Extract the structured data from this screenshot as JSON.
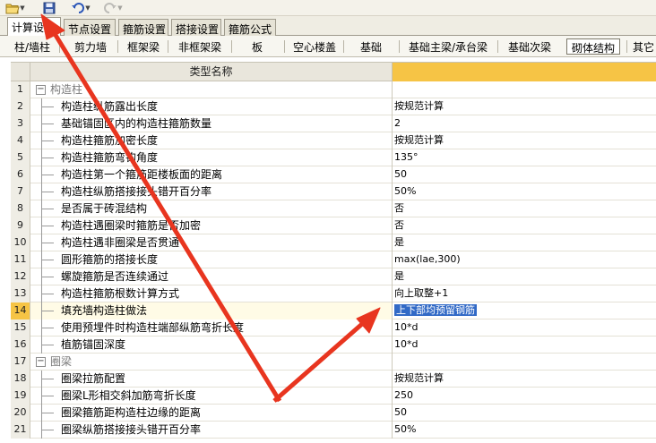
{
  "toolbar": {
    "icons": [
      "open-folder-icon",
      "save-icon",
      "undo-icon",
      "redo-icon"
    ]
  },
  "tabs_top": [
    {
      "label": "计算设置",
      "active": true
    },
    {
      "label": "节点设置",
      "active": false
    },
    {
      "label": "箍筋设置",
      "active": false
    },
    {
      "label": "搭接设置",
      "active": false
    },
    {
      "label": "箍筋公式",
      "active": false
    }
  ],
  "tabs_components": [
    {
      "label": "柱/墙柱",
      "active": false
    },
    {
      "label": "剪力墙",
      "active": false
    },
    {
      "label": "框架梁",
      "active": false
    },
    {
      "label": "非框架梁",
      "active": false
    },
    {
      "label": "板",
      "active": false
    },
    {
      "label": "空心楼盖",
      "active": false
    },
    {
      "label": "基础",
      "active": false
    },
    {
      "label": "基础主梁/承台梁",
      "active": false
    },
    {
      "label": "基础次梁",
      "active": false
    },
    {
      "label": "砌体结构",
      "active": true
    },
    {
      "label": "其它",
      "active": false
    }
  ],
  "grid": {
    "header_name": "类型名称",
    "header_value": "",
    "rows": [
      {
        "num": "1",
        "type": "group",
        "name": "构造柱",
        "value": ""
      },
      {
        "num": "2",
        "type": "item",
        "name": "构造柱纵筋露出长度",
        "value": "按规范计算"
      },
      {
        "num": "3",
        "type": "item",
        "name": "基础锚固区内的构造柱箍筋数量",
        "value": "2"
      },
      {
        "num": "4",
        "type": "item",
        "name": "构造柱箍筋加密长度",
        "value": "按规范计算"
      },
      {
        "num": "5",
        "type": "item",
        "name": "构造柱箍筋弯钩角度",
        "value": "135°"
      },
      {
        "num": "6",
        "type": "item",
        "name": "构造柱第一个箍筋距楼板面的距离",
        "value": "50"
      },
      {
        "num": "7",
        "type": "item",
        "name": "构造柱纵筋搭接接头错开百分率",
        "value": "50%"
      },
      {
        "num": "8",
        "type": "item",
        "name": "是否属于砖混结构",
        "value": "否"
      },
      {
        "num": "9",
        "type": "item",
        "name": "构造柱遇圈梁时箍筋是否加密",
        "value": "否"
      },
      {
        "num": "10",
        "type": "item",
        "name": "构造柱遇非圈梁是否贯通",
        "value": "是"
      },
      {
        "num": "11",
        "type": "item",
        "name": "圆形箍筋的搭接长度",
        "value": "max(lae,300)"
      },
      {
        "num": "12",
        "type": "item",
        "name": "螺旋箍筋是否连续通过",
        "value": "是"
      },
      {
        "num": "13",
        "type": "item",
        "name": "构造柱箍筋根数计算方式",
        "value": "向上取整+1"
      },
      {
        "num": "14",
        "type": "item",
        "name": "填充墙构造柱做法",
        "value": "上下部均预留钢筋",
        "selected": true
      },
      {
        "num": "15",
        "type": "item",
        "name": "使用预埋件时构造柱端部纵筋弯折长度",
        "value": "10*d"
      },
      {
        "num": "16",
        "type": "item",
        "name": "植筋锚固深度",
        "value": "10*d"
      },
      {
        "num": "17",
        "type": "group",
        "name": "圈梁",
        "value": ""
      },
      {
        "num": "18",
        "type": "item",
        "name": "圈梁拉筋配置",
        "value": "按规范计算"
      },
      {
        "num": "19",
        "type": "item",
        "name": "圈梁L形相交斜加筋弯折长度",
        "value": "250"
      },
      {
        "num": "20",
        "type": "item",
        "name": "圈梁箍筋距构造柱边缘的距离",
        "value": "50"
      },
      {
        "num": "21",
        "type": "item",
        "name": "圈梁纵筋搭接接头错开百分率",
        "value": "50%"
      }
    ]
  },
  "colors": {
    "header_accent": "#f6c445",
    "selection": "#3169c6",
    "annotation_arrow": "#e8351f"
  }
}
